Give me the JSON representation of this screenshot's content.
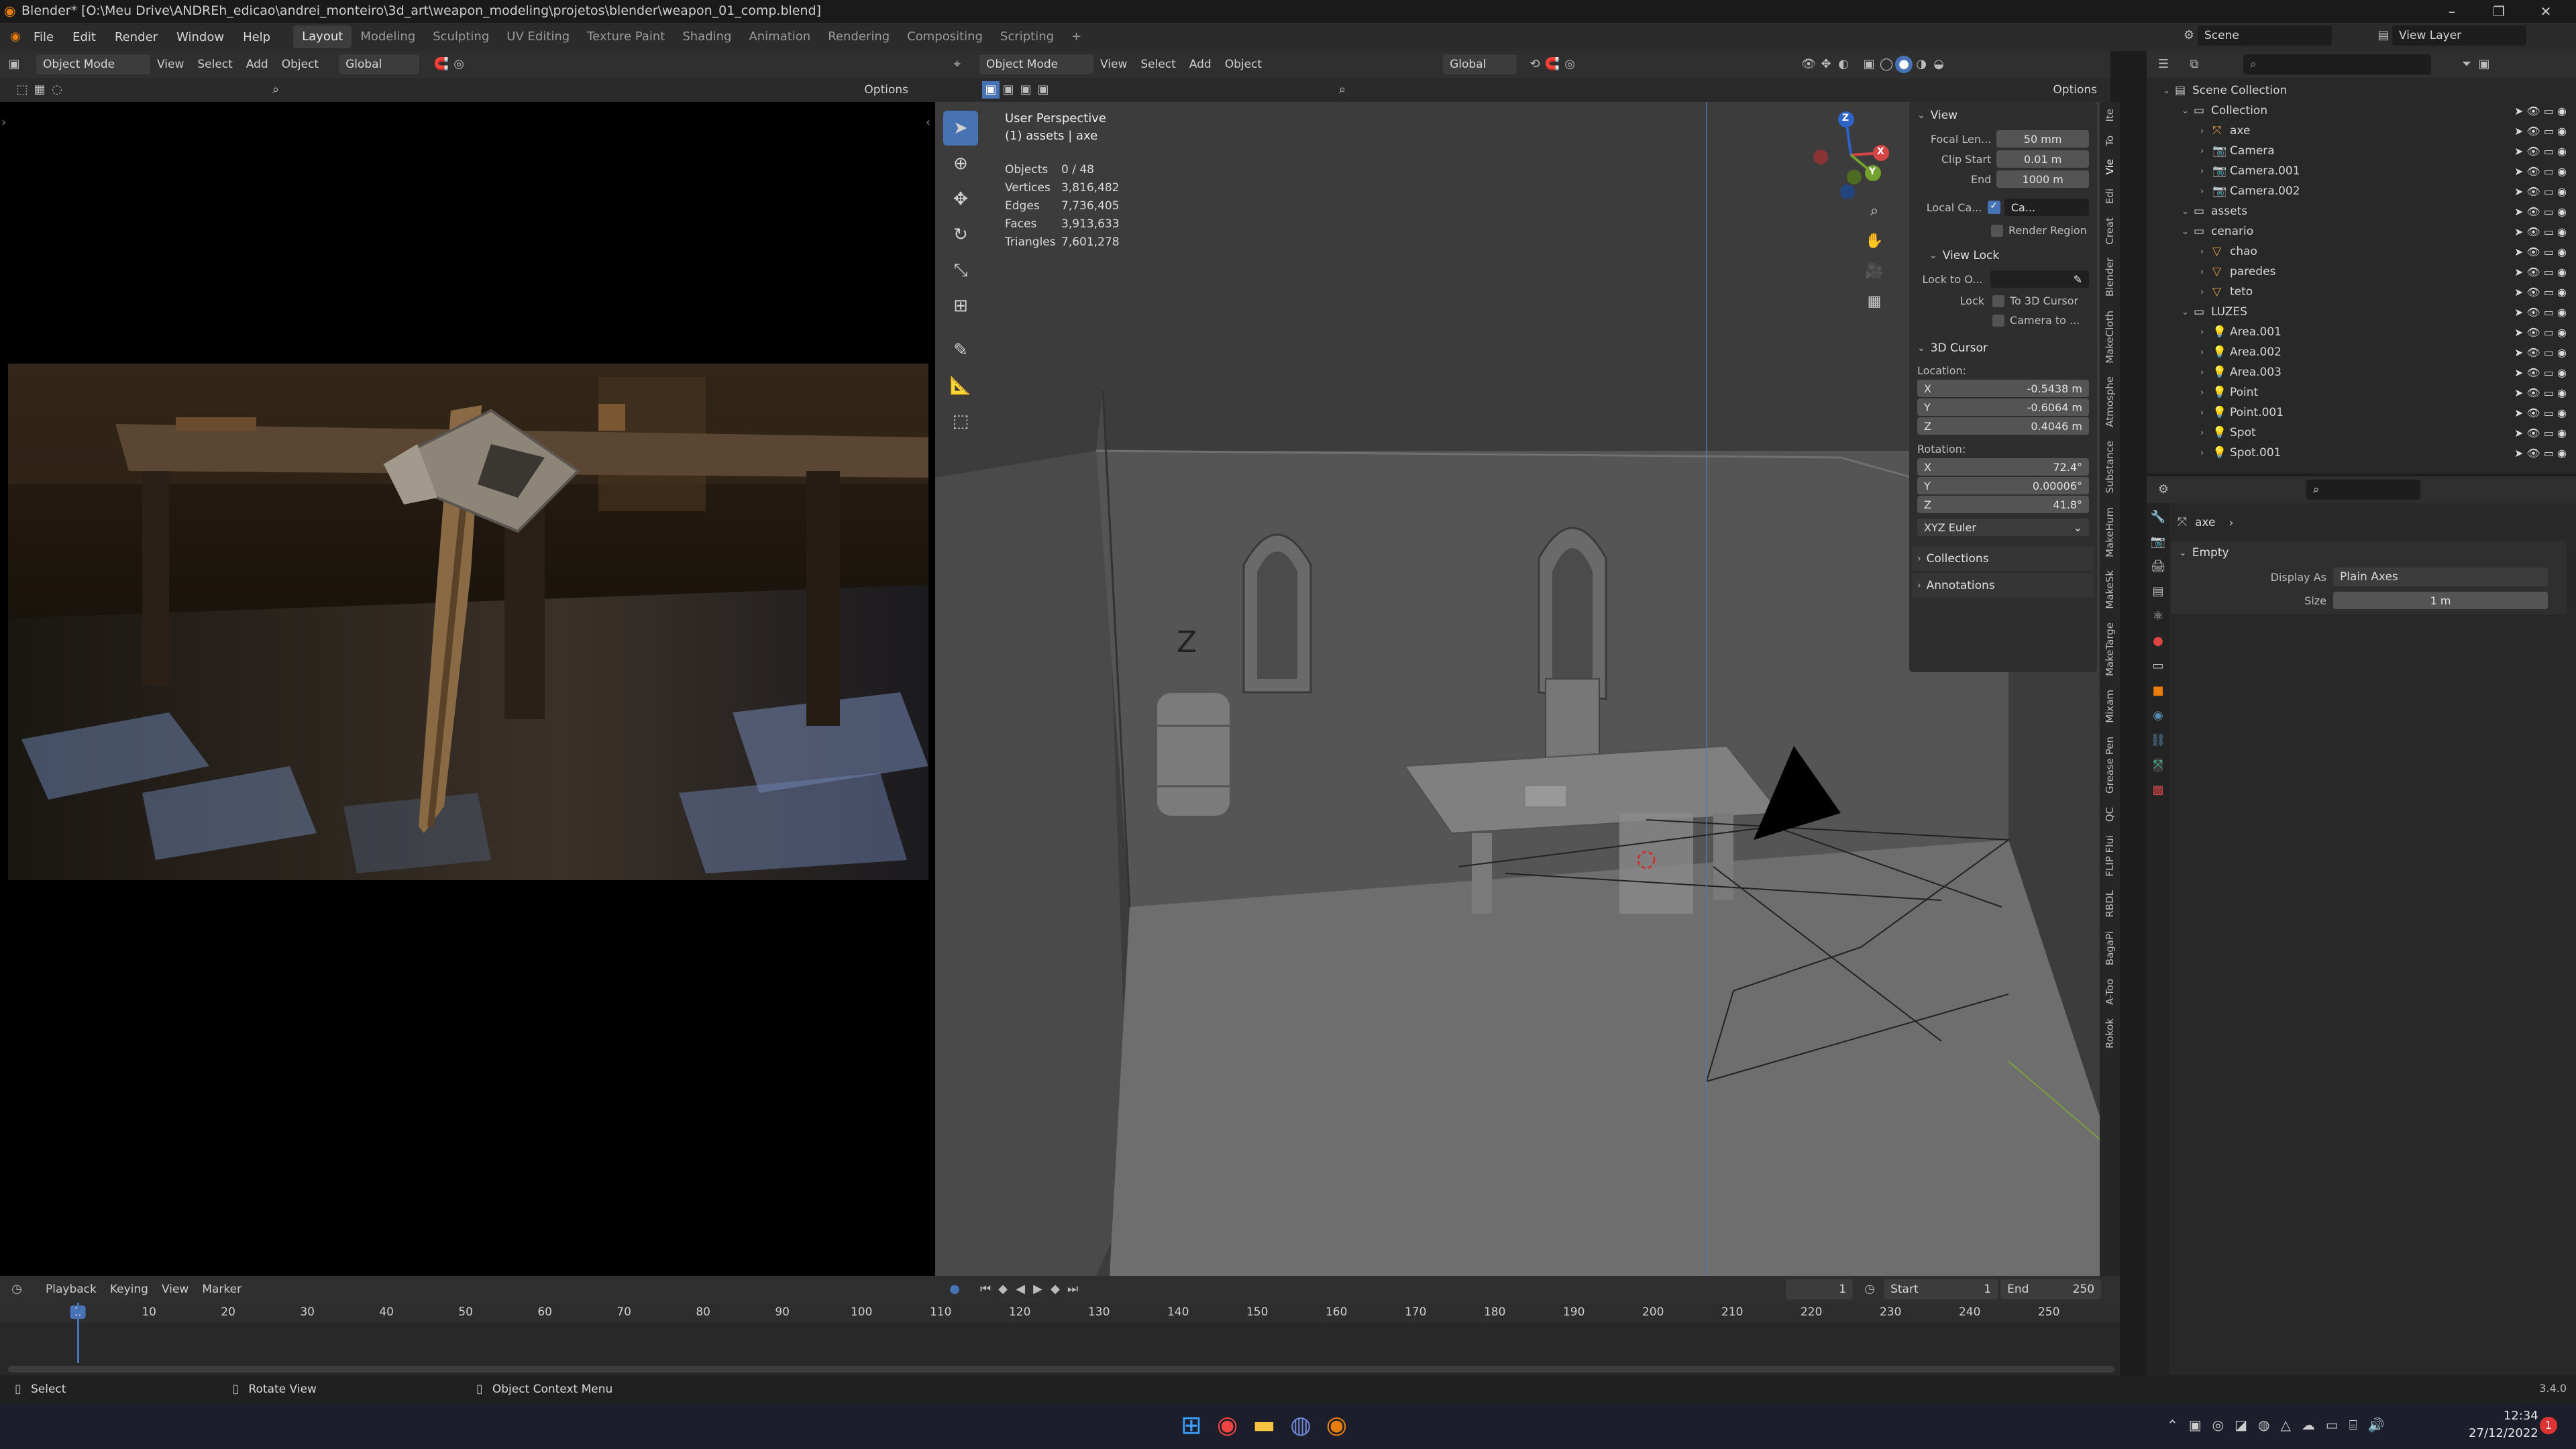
{
  "window": {
    "title": "Blender* [O:\\Meu Drive\\ANDREh_edicao\\andrei_monteiro\\3d_art\\weapon_modeling\\projetos\\blender\\weapon_01_comp.blend]",
    "minimize": "–",
    "maximize": "❐",
    "close": "✕"
  },
  "menu": {
    "items": [
      "File",
      "Edit",
      "Render",
      "Window",
      "Help"
    ],
    "workspaces": [
      "Layout",
      "Modeling",
      "Sculpting",
      "UV Editing",
      "Texture Paint",
      "Shading",
      "Animation",
      "Rendering",
      "Compositing",
      "Scripting"
    ],
    "active_workspace": "Layout",
    "add_tab": "+",
    "scene_label": "Scene",
    "view_layer_label": "View Layer"
  },
  "image_editor": {
    "mode": "Object Mode",
    "menus": [
      "View",
      "Select",
      "Add",
      "Object"
    ],
    "orientation": "Global",
    "options": "Options"
  },
  "viewport": {
    "mode": "Object Mode",
    "menus": [
      "View",
      "Select",
      "Add",
      "Object"
    ],
    "orientation": "Global",
    "options": "Options",
    "overlay_title": "User Perspective",
    "overlay_subtitle": "(1) assets | axe",
    "stats": [
      {
        "label": "Objects",
        "value": "0 / 48"
      },
      {
        "label": "Vertices",
        "value": "3,816,482"
      },
      {
        "label": "Edges",
        "value": "7,736,405"
      },
      {
        "label": "Faces",
        "value": "3,913,633"
      },
      {
        "label": "Triangles",
        "value": "7,601,278"
      }
    ],
    "axis_z": "Z",
    "axis_x": "X",
    "axis_y": "Y"
  },
  "npanel": {
    "view_header": "View",
    "focal_label": "Focal Len...",
    "focal_value": "50 mm",
    "clip_start_label": "Clip Start",
    "clip_start_value": "0.01 m",
    "end_label": "End",
    "end_value": "1000 m",
    "local_cam_label": "Local Ca...",
    "local_cam_value": "Ca...",
    "render_region": "Render Region",
    "view_lock_header": "View Lock",
    "lock_to_label": "Lock to O...",
    "lock_label": "Lock",
    "to_3d_cursor": "To 3D Cursor",
    "camera_to": "Camera to ...",
    "cursor_header": "3D Cursor",
    "location_label": "Location:",
    "loc_x": "-0.5438 m",
    "loc_y": "-0.6064 m",
    "loc_z": "0.4046 m",
    "rotation_label": "Rotation:",
    "rot_x": "72.4°",
    "rot_y": "0.00006°",
    "rot_z": "41.8°",
    "rot_mode": "XYZ Euler",
    "collections": "Collections",
    "annotations": "Annotations",
    "x": "X",
    "y": "Y",
    "z": "Z",
    "tabs": [
      "Ite",
      "To",
      "Vie",
      "Edi",
      "Creat",
      "Blender",
      "MakeCloth",
      "Atmosphe",
      "Substance",
      "MakeHum",
      "MakeSk",
      "MakeTarge",
      "Mixam",
      "Grease Pen",
      "QC",
      "FLIP Flui",
      "RBDL",
      "BagaPi",
      "A-Too",
      "Rokok"
    ]
  },
  "outliner": {
    "rows": [
      {
        "label": "Scene Collection",
        "depth": 0,
        "type": "scene"
      },
      {
        "label": "Collection",
        "depth": 1,
        "type": "collection"
      },
      {
        "label": "axe",
        "depth": 2,
        "type": "empty"
      },
      {
        "label": "Camera",
        "depth": 2,
        "type": "camera"
      },
      {
        "label": "Camera.001",
        "depth": 2,
        "type": "camera"
      },
      {
        "label": "Camera.002",
        "depth": 2,
        "type": "camera"
      },
      {
        "label": "assets",
        "depth": 1,
        "type": "collection"
      },
      {
        "label": "cenario",
        "depth": 1,
        "type": "collection"
      },
      {
        "label": "chao",
        "depth": 2,
        "type": "mesh"
      },
      {
        "label": "paredes",
        "depth": 2,
        "type": "mesh"
      },
      {
        "label": "teto",
        "depth": 2,
        "type": "mesh"
      },
      {
        "label": "LUZES",
        "depth": 1,
        "type": "collection"
      },
      {
        "label": "Area.001",
        "depth": 2,
        "type": "light"
      },
      {
        "label": "Area.002",
        "depth": 2,
        "type": "light"
      },
      {
        "label": "Area.003",
        "depth": 2,
        "type": "light"
      },
      {
        "label": "Point",
        "depth": 2,
        "type": "light"
      },
      {
        "label": "Point.001",
        "depth": 2,
        "type": "light"
      },
      {
        "label": "Spot",
        "depth": 2,
        "type": "light"
      },
      {
        "label": "Spot.001",
        "depth": 2,
        "type": "light"
      }
    ]
  },
  "properties": {
    "object": "axe",
    "section": "Empty",
    "display_as_label": "Display As",
    "display_as_value": "Plain Axes",
    "size_label": "Size",
    "size_value": "1 m"
  },
  "timeline": {
    "menus": [
      "Playback",
      "Keying",
      "View",
      "Marker"
    ],
    "current_frame": "1",
    "start_label": "Start",
    "start_value": "1",
    "end_label": "End",
    "end_value": "250",
    "ticks": [
      "1",
      "10",
      "20",
      "30",
      "40",
      "50",
      "60",
      "70",
      "80",
      "90",
      "100",
      "110",
      "120",
      "130",
      "140",
      "150",
      "160",
      "170",
      "180",
      "190",
      "200",
      "210",
      "220",
      "230",
      "240",
      "250"
    ]
  },
  "statusbar": {
    "select": "Select",
    "rotate": "Rotate View",
    "context": "Object Context Menu",
    "version": "3.4.0"
  },
  "taskbar": {
    "time": "12:34",
    "date": "27/12/2022",
    "notif_count": "1"
  },
  "colors": {
    "accent": "#4772b3",
    "header": "#2f2f2f",
    "panel": "#282828"
  }
}
